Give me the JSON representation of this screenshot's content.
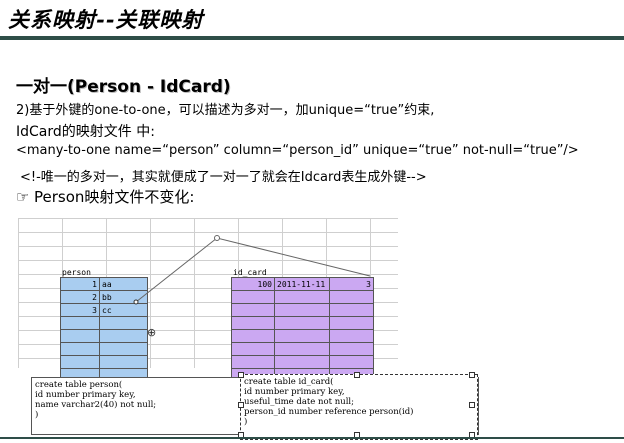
{
  "header": {
    "title": "关系映射--关联映射"
  },
  "content": {
    "heading_prefix": "一对一",
    "heading_rest": "(Person - IdCard)",
    "line1": "2)基于外键的one-to-one，可以描述为多对一，加unique=“true”约束,",
    "line2": "IdCard的映射文件 中:",
    "line3": "<many-to-one name=“person” column=“person_id” unique=“true” not-null=“true”/>",
    "line4": "<!-唯一的多对一，其实就便成了一对一了就会在Idcard表生成外键-->",
    "line5": "Person映射文件不变化:"
  },
  "figure": {
    "person_table": {
      "name": "person",
      "rows": [
        {
          "id": "1",
          "name": "aa"
        },
        {
          "id": "2",
          "name": "bb"
        },
        {
          "id": "3",
          "name": "cc"
        }
      ]
    },
    "idcard_table": {
      "name": "id_card",
      "rows": [
        {
          "id": "100",
          "useful_time": "2011-11-11",
          "person_id": "3"
        }
      ]
    },
    "person_sql": [
      "create table person(",
      "id number primary key,",
      "name varchar2(40) not null;",
      ")"
    ],
    "idcard_sql": [
      "create table id_card(",
      "id number primary key,",
      "useful_time date not null;",
      "person_id number reference person(id)",
      ")"
    ]
  }
}
